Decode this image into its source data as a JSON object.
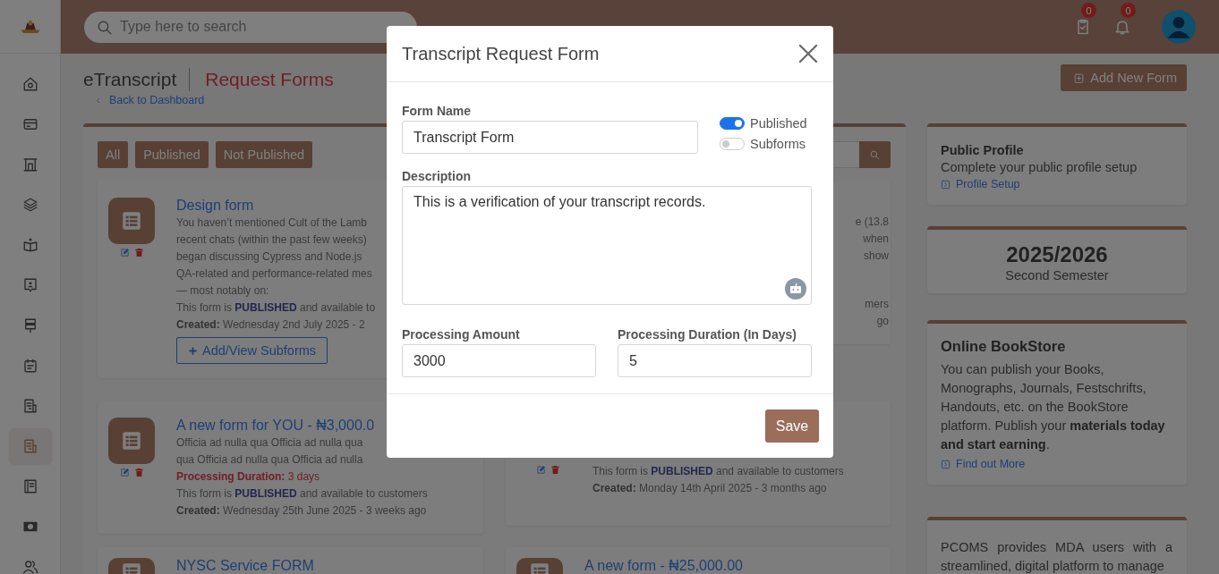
{
  "sidebar": {
    "items": [
      {
        "kind": "home",
        "selected": false
      },
      {
        "kind": "card",
        "selected": false
      },
      {
        "kind": "building",
        "selected": false
      },
      {
        "kind": "layers",
        "selected": false
      },
      {
        "kind": "reader",
        "selected": false
      },
      {
        "kind": "contact",
        "selected": false
      },
      {
        "kind": "signpost",
        "selected": false
      },
      {
        "kind": "calendar",
        "selected": false
      },
      {
        "kind": "news",
        "selected": false
      },
      {
        "kind": "news",
        "selected": true
      },
      {
        "kind": "notebook",
        "selected": false
      },
      {
        "kind": "money",
        "selected": false
      },
      {
        "kind": "users",
        "selected": false
      }
    ]
  },
  "header": {
    "search": {
      "placeholder": "Type here to search"
    },
    "tasks_badge": "0",
    "notifications_badge": "0"
  },
  "page": {
    "app": "eTranscript",
    "title": "Request Forms",
    "back_link": "Back to Dashboard",
    "add_button": "Add New Form"
  },
  "filters": [
    {
      "label": "All"
    },
    {
      "label": "Published"
    },
    {
      "label": "Not Published"
    }
  ],
  "forms": [
    {
      "kind": "full",
      "title": "Design form",
      "lines": [
        {
          "kind": "body",
          "text": "You haven’t mentioned Cult of the Lamb"
        },
        {
          "kind": "body",
          "text": "recent chats (within the past few weeks)"
        },
        {
          "kind": "body",
          "text": "began discussing Cypress and Node.js"
        },
        {
          "kind": "body",
          "text": "QA-related and performance-related mes"
        },
        {
          "kind": "body",
          "text": "— most notably on:"
        },
        {
          "kind": "status",
          "text": "This form is **PUBLISHED** and available to"
        },
        {
          "kind": "created",
          "text": "**Created:** Wednesday 2nd July 2025 - 2"
        }
      ],
      "button": "Add/View Subforms"
    },
    {
      "kind": "fragment",
      "lines": [
        {
          "kind": "body",
          "text": "e (13.8"
        },
        {
          "kind": "body",
          "text": "when"
        },
        {
          "kind": "body",
          "text": "show"
        },
        {
          "kind": "status",
          "text": "mers"
        },
        {
          "kind": "created",
          "text": "go"
        }
      ]
    },
    {
      "kind": "full",
      "title": "A new form for YOU - ₦3,000.0",
      "lines": [
        {
          "kind": "body",
          "text": "Officia ad nulla qua Officia ad nulla qua"
        },
        {
          "kind": "body",
          "text": "qua Officia ad nulla qua Officia ad nulla"
        },
        {
          "kind": "duration",
          "text": "**Processing Duration:** 3 days"
        },
        {
          "kind": "status",
          "text": "This form is **PUBLISHED** and available to customers"
        },
        {
          "kind": "created",
          "text": "**Created:** Wednesday 25th June 2025 - 3 weeks ago"
        }
      ]
    },
    {
      "kind": "lower",
      "lines": [
        {
          "kind": "status",
          "text": "This form is **PUBLISHED** and available to customers"
        },
        {
          "kind": "created",
          "text": "**Created:** Monday 14th April 2025 - 3 months ago"
        }
      ]
    },
    {
      "kind": "top",
      "title": "NYSC Service FORM"
    },
    {
      "kind": "top",
      "title": "A new form - ₦25,000.00"
    }
  ],
  "aside": {
    "profile": {
      "title": "Public Profile",
      "text": "Complete your public profile setup",
      "link": "Profile Setup"
    },
    "session": {
      "year": "2025/2026",
      "semester": "Second Semester"
    },
    "bookstore": {
      "title": "Online BookStore",
      "text": "You can publish your Books, Monographs, Journals, Festschrifts, Handouts, etc. on the BookStore platform. Publish your **materials today and start earning**.",
      "link": "Find out More"
    },
    "pcoms": {
      "text": "PCOMS provides MDA users with a streamlined, digital platform to manage"
    }
  },
  "modal": {
    "title": "Transcript Request Form",
    "form_name": {
      "label": "Form Name",
      "value": "Transcript Form"
    },
    "toggles": [
      {
        "label": "Published",
        "on": true
      },
      {
        "label": "Subforms",
        "on": false
      }
    ],
    "description": {
      "label": "Description",
      "value": "This is a verification of your transcript records."
    },
    "amount": {
      "label": "Processing Amount",
      "value": "3000"
    },
    "duration": {
      "label": "Processing Duration (In Days)",
      "value": "5"
    },
    "save": "Save"
  }
}
